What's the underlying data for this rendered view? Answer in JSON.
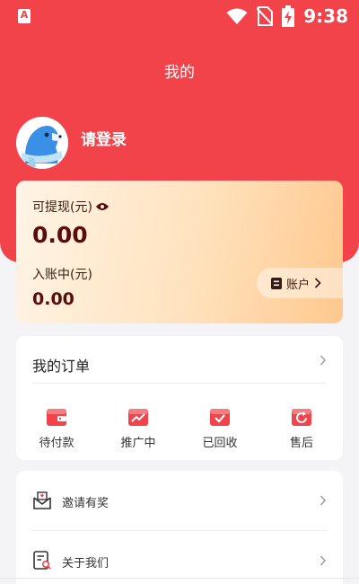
{
  "status_bar": {
    "app_icon": "A",
    "time": "9:38"
  },
  "header": {
    "title": "我的"
  },
  "profile": {
    "login_text": "请登录"
  },
  "wallet": {
    "withdrawable_label": "可提现(元)",
    "withdrawable_amount": "0.00",
    "pending_label": "入账中(元)",
    "pending_amount": "0.00",
    "account_label": "账户"
  },
  "orders": {
    "title": "我的订单",
    "items": [
      {
        "label": "待付款",
        "icon": "wallet-icon"
      },
      {
        "label": "推广中",
        "icon": "trend-icon"
      },
      {
        "label": "已回收",
        "icon": "check-box-icon"
      },
      {
        "label": "售后",
        "icon": "refresh-icon"
      }
    ]
  },
  "menu": {
    "items": [
      {
        "label": "邀请有奖",
        "icon": "invite-envelope-icon"
      },
      {
        "label": "关于我们",
        "icon": "about-document-icon"
      }
    ]
  },
  "colors": {
    "primary": "#f2434a",
    "amount": "#5a0d0d"
  }
}
